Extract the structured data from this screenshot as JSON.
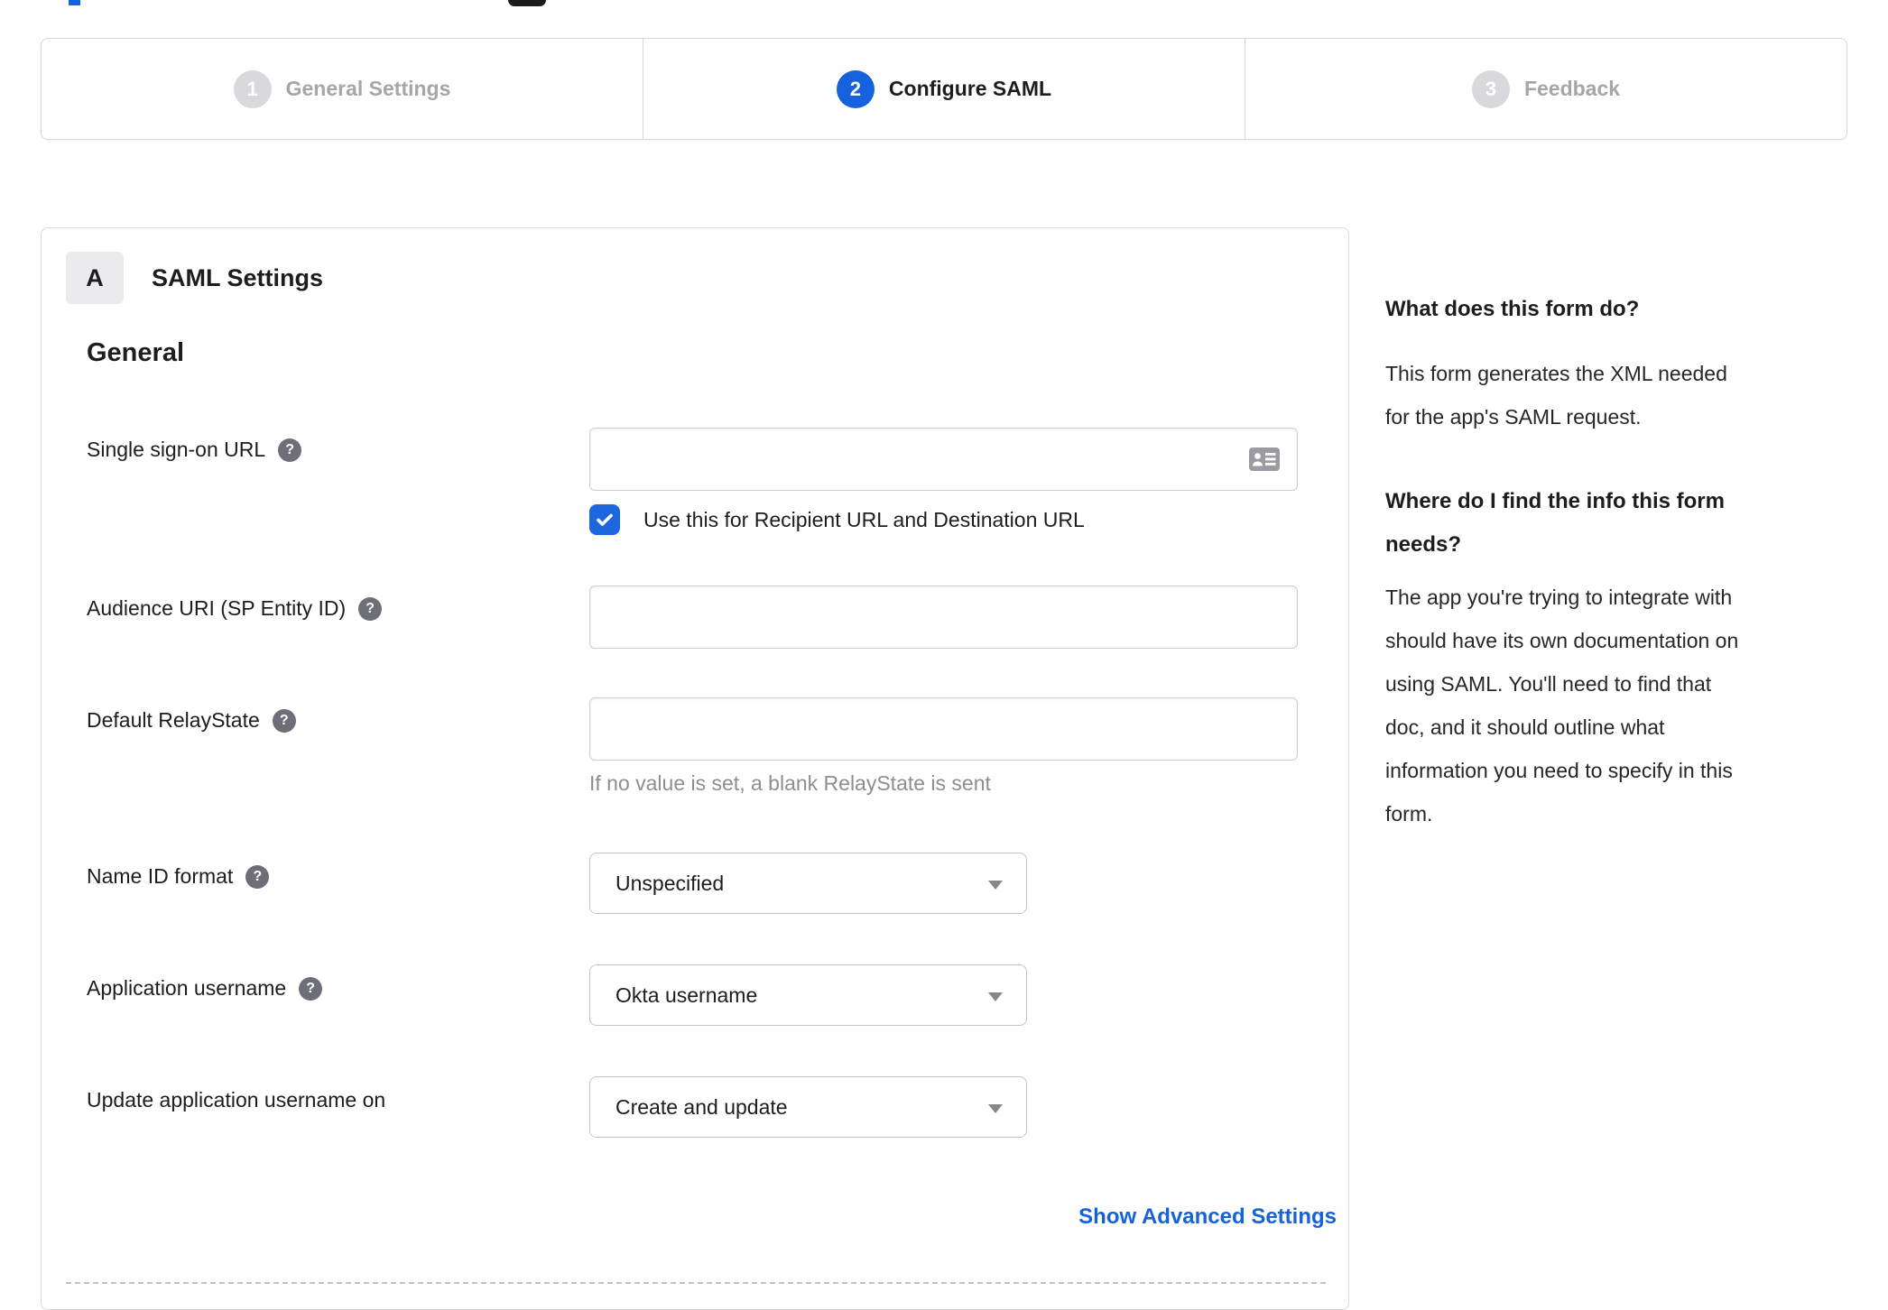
{
  "stepper": {
    "steps": [
      {
        "number": "1",
        "label": "General Settings",
        "active": false
      },
      {
        "number": "2",
        "label": "Configure SAML",
        "active": true
      },
      {
        "number": "3",
        "label": "Feedback",
        "active": false
      }
    ]
  },
  "saml_panel": {
    "badge": "A",
    "title": "SAML Settings",
    "section_heading": "General",
    "sso_url": {
      "label": "Single sign-on URL",
      "value": "",
      "checkbox_checked": true,
      "checkbox_label": "Use this for Recipient URL and Destination URL"
    },
    "audience_uri": {
      "label": "Audience URI (SP Entity ID)",
      "value": ""
    },
    "relay_state": {
      "label": "Default RelayState",
      "value": "",
      "hint": "If no value is set, a blank RelayState is sent"
    },
    "name_id_format": {
      "label": "Name ID format",
      "value": "Unspecified"
    },
    "app_username": {
      "label": "Application username",
      "value": "Okta username"
    },
    "update_username": {
      "label": "Update application username on",
      "value": "Create and update"
    },
    "advanced_link": "Show Advanced Settings"
  },
  "help_sidebar": {
    "q1": "What does this form do?",
    "a1": [
      "This form generates the XML needed",
      "for the app's SAML request."
    ],
    "q2": [
      "Where do I find the info this form",
      "needs?"
    ],
    "a2": [
      "The app you're trying to integrate with",
      "should have its own documentation on",
      "using SAML. You'll need to find that",
      "doc, and it should outline what",
      "information you need to specify in this",
      "form."
    ]
  },
  "colors": {
    "accent_blue": "#1662dd",
    "border_grey": "#d7d7dc",
    "inactive_step_text": "#a4a6ab",
    "hint_text": "#8d8d93",
    "help_icon_bg": "#6e6e78"
  }
}
